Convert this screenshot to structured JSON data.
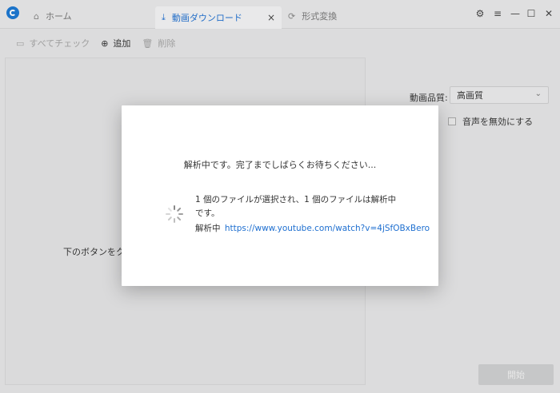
{
  "tabs": {
    "home": "ホーム",
    "download": "動画ダウンロード",
    "convert": "形式変換",
    "close_glyph": "×"
  },
  "toolbar": {
    "check_all": "すべてチェック",
    "add": "追加",
    "delete": "削除"
  },
  "main": {
    "hint": "下のボタンをク"
  },
  "settings": {
    "quality_label": "動画品質:",
    "quality_value": "高画質",
    "mute_label": "音声を無効にする"
  },
  "footer": {
    "start_label": "開始"
  },
  "modal": {
    "message": "解析中です。完了までしばらくお待ちください...",
    "status": "1 個のファイルが選択され、1 個のファイルは解析中です。",
    "analyzing_label": "解析中",
    "url": "https://www.youtube.com/watch?v=4jSfOBxBero"
  },
  "colors": {
    "accent": "#1e6fd0",
    "logo": "#1976d2",
    "start_button": "#cfd0d1"
  }
}
